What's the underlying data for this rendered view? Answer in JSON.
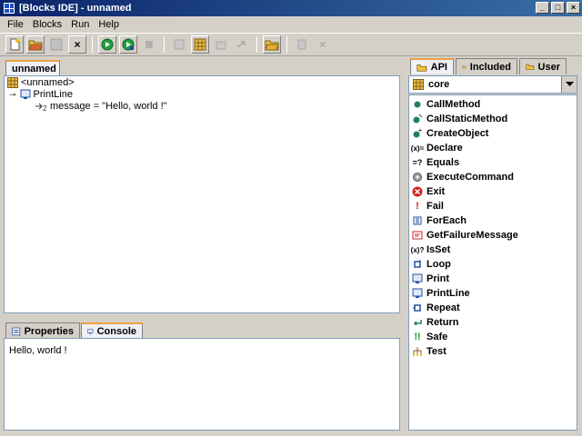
{
  "window": {
    "title": "[Blocks IDE] - unnamed"
  },
  "menu": {
    "items": [
      "File",
      "Blocks",
      "Run",
      "Help"
    ]
  },
  "editor": {
    "tab_label": "unnamed",
    "tree": {
      "root": "<unnamed>",
      "child": "PrintLine",
      "param": "message = \"Hello, world !\""
    }
  },
  "bottom": {
    "tabs": [
      "Properties",
      "Console"
    ],
    "console_output": "Hello, world !"
  },
  "right": {
    "tabs": [
      "API",
      "Included",
      "User"
    ],
    "combo_value": "core",
    "api_items": [
      "CallMethod",
      "CallStaticMethod",
      "CreateObject",
      "Declare",
      "Equals",
      "ExecuteCommand",
      "Exit",
      "Fail",
      "ForEach",
      "GetFailureMessage",
      "IsSet",
      "Loop",
      "Print",
      "PrintLine",
      "Repeat",
      "Return",
      "Safe",
      "Test"
    ]
  },
  "colors": {
    "title_start": "#0a246a",
    "title_end": "#3a6ea5",
    "panel_border": "#7f9db9",
    "tab_accent": "#f0a040"
  }
}
